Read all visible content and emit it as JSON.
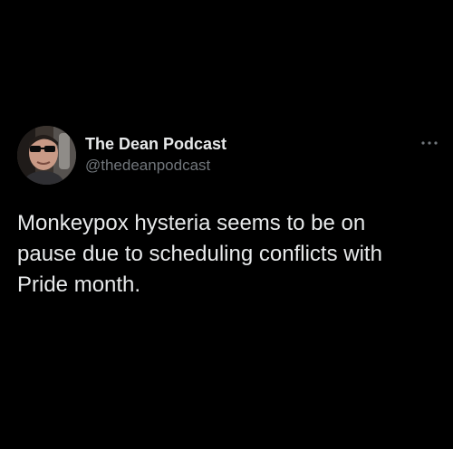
{
  "tweet": {
    "author": {
      "display_name": "The Dean Podcast",
      "handle": "@thedeanpodcast",
      "avatar_icon": "profile-photo-icon"
    },
    "more_icon": "more-options-icon",
    "text": "Monkeypox hysteria seems to be on\npause due to scheduling conflicts with\nPride month."
  },
  "theme": {
    "background": "#000000",
    "text_primary": "#e7e9ea",
    "text_secondary": "#71767b"
  }
}
